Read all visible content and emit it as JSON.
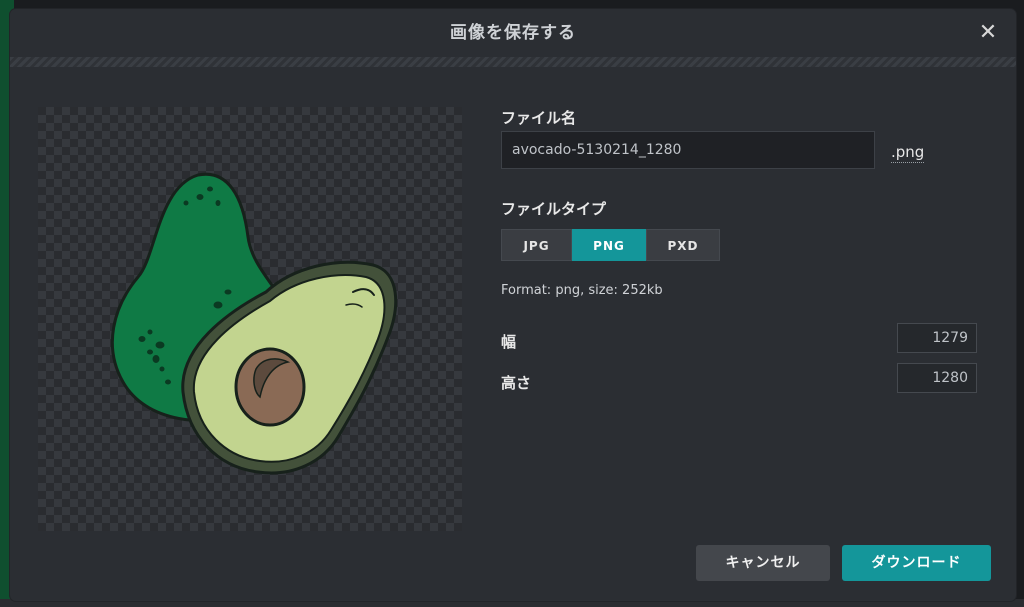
{
  "dialog": {
    "title": "画像を保存する",
    "close_glyph": "✕"
  },
  "filename": {
    "label": "ファイル名",
    "value": "avocado-5130214_1280",
    "extension": ".png"
  },
  "filetype": {
    "label": "ファイルタイプ",
    "options": [
      "JPG",
      "PNG",
      "PXD"
    ],
    "selected": "PNG"
  },
  "format_info": "Format: png, size: 252kb",
  "dimensions": {
    "width_label": "幅",
    "width_value": "1279",
    "height_label": "高さ",
    "height_value": "1280"
  },
  "buttons": {
    "cancel": "キャンセル",
    "download": "ダウンロード"
  },
  "colors": {
    "accent": "#14969a",
    "dialog_bg": "#2b2e33"
  },
  "icons": [
    "close-icon"
  ]
}
